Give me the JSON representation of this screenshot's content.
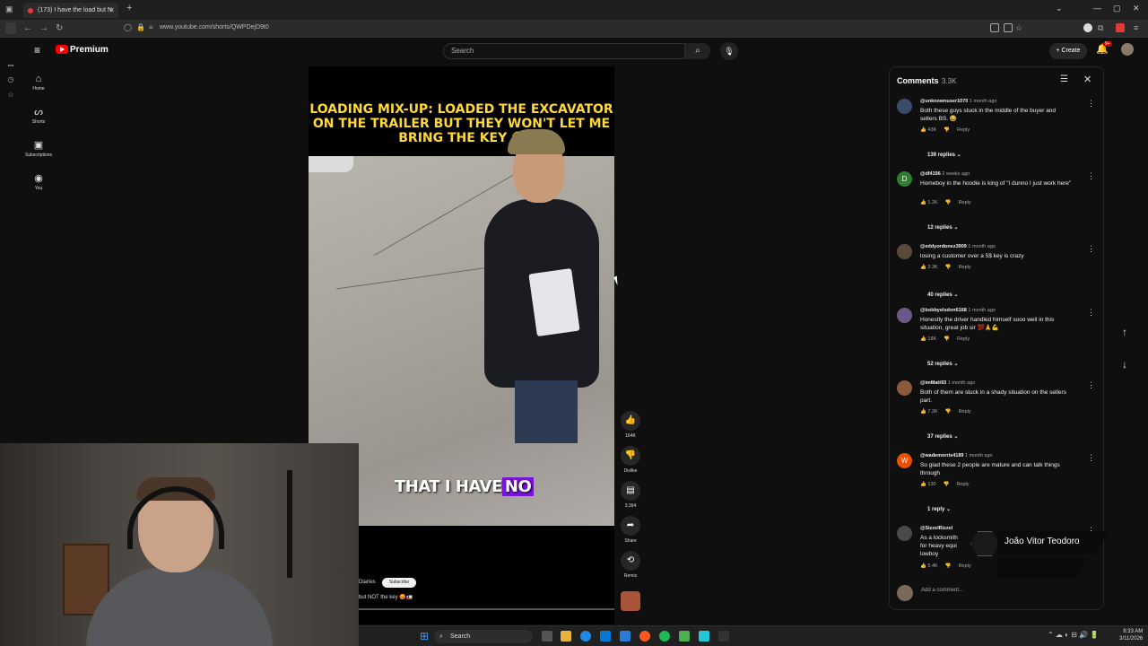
{
  "browser": {
    "tab_title": "(173) I have the load but N",
    "url": "www.youtube.com/shorts/QWPDejD9t0"
  },
  "youtube": {
    "logo": "Premium",
    "search_placeholder": "Search",
    "create_label": "Create",
    "notification_badge": "9+"
  },
  "sidenav": [
    {
      "label": "Home",
      "icon": "home-icon"
    },
    {
      "label": "Shorts",
      "icon": "shorts-icon"
    },
    {
      "label": "Subscriptions",
      "icon": "subscriptions-icon"
    },
    {
      "label": "You",
      "icon": "you-icon"
    }
  ],
  "video": {
    "headline": "LOADING MIX-UP: LOADED THE EXCAVATOR ON THE TRAILER BUT THEY WON'T LET ME BRING THE KEY 😡",
    "caption_plain": "THAT I HAVE",
    "caption_highlight": "NO",
    "channel": "Diaries",
    "subscribe_label": "Subscribe",
    "title_partial": "but NOT the key 😡🚛"
  },
  "actions": [
    {
      "label": "164K",
      "icon": "like-icon"
    },
    {
      "label": "Dislike",
      "icon": "dislike-icon"
    },
    {
      "label": "3,394",
      "icon": "comment-icon"
    },
    {
      "label": "Share",
      "icon": "share-icon"
    },
    {
      "label": "Remix",
      "icon": "remix-icon"
    }
  ],
  "comments_panel": {
    "title": "Comments",
    "count": "3.3K",
    "add_placeholder": "Add a comment...",
    "items": [
      {
        "handle": "@unknownuser1070",
        "time": "1 month ago",
        "text": "Both these guys stuck in the middle of the buyer and sellers BS. 😂",
        "likes": "43K",
        "replies": "139 replies",
        "avatar_letter": "",
        "avatar_color": "#3a4a6a"
      },
      {
        "handle": "@df4196",
        "time": "2 weeks ago",
        "text": "Homeboy in the hoodie is king of \"I dunno I just work here\"",
        "likes": "1.2K",
        "replies": "12 replies",
        "avatar_letter": "D",
        "avatar_color": "#2e7d32"
      },
      {
        "handle": "@eddyordonez3909",
        "time": "1 month ago",
        "text": "losing a customer over a 5$ key is crazy",
        "likes": "3.3K",
        "replies": "40 replies",
        "avatar_letter": "",
        "avatar_color": "#5a4a3a"
      },
      {
        "handle": "@bobbyelsdon6168",
        "time": "1 month ago",
        "text": "Honestly the driver handled himself sooo well in this situation,  great job sir 💯🙏💪",
        "likes": "18K",
        "replies": "52 replies",
        "avatar_letter": "",
        "avatar_color": "#6a5a8a"
      },
      {
        "handle": "@imMatt93",
        "time": "1 month ago",
        "text": "Both of them are stuck in a shady situation on the sellers part.",
        "likes": "7.2K",
        "replies": "37 replies",
        "avatar_letter": "",
        "avatar_color": "#8a5a3a"
      },
      {
        "handle": "@wademorris4189",
        "time": "1 month ago",
        "text": "So glad these 2 people are mature and can talk things through",
        "likes": "130",
        "replies": "1 reply",
        "avatar_letter": "W",
        "avatar_color": "#e65100"
      },
      {
        "handle": "@SizzelRizzel",
        "time": "",
        "text": "As a locksmith for heavy equi lowboy",
        "likes": "5.4K",
        "replies": "",
        "avatar_letter": "",
        "avatar_color": "#4a4a4a"
      }
    ],
    "reply_label": "Reply"
  },
  "overlay": {
    "name": "João Vitor Teodoro"
  },
  "taskbar": {
    "search": "Search",
    "time": "8:33 AM",
    "date": "3/11/2026"
  }
}
